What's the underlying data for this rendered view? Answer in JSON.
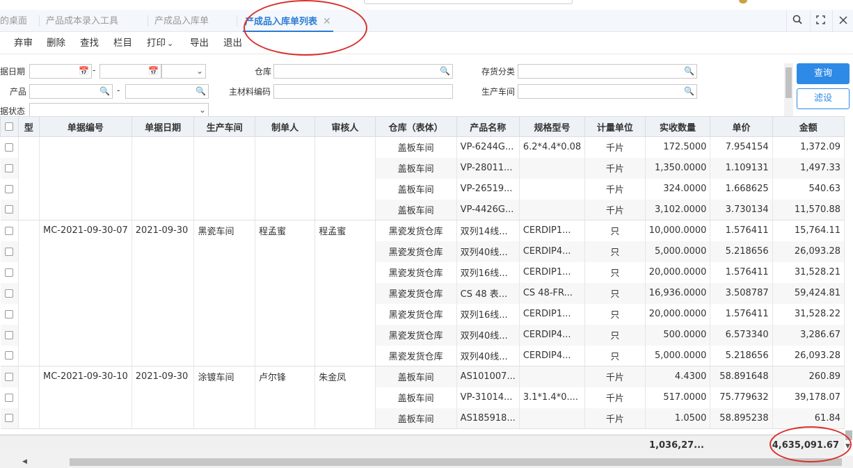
{
  "tabs": [
    {
      "label": "的桌面"
    },
    {
      "label": "产品成本录入工具"
    },
    {
      "label": "产成品入库单"
    },
    {
      "label": "产成品入库单列表",
      "close": "✕"
    }
  ],
  "toolbar": [
    "弃审",
    "删除",
    "查找",
    "栏目",
    "打印",
    "导出",
    "退出"
  ],
  "toolbar_print_caret": "⌄",
  "window_icons": [
    "search-icon",
    "fullscreen-icon",
    "close-icon"
  ],
  "filters": {
    "date_label": "据日期",
    "dash": "-",
    "warehouse_label": "仓库",
    "category_label": "存货分类",
    "product_label": "产品",
    "material_label": "主材料编码",
    "workshop_label": "生产车间",
    "status_label": "据状态"
  },
  "buttons": {
    "query": "查询",
    "filter": "滤设"
  },
  "columns": [
    "型",
    "单据编号",
    "单据日期",
    "生产车间",
    "制单人",
    "审核人",
    "仓库（表体）",
    "产品名称",
    "规格型号",
    "计量单位",
    "实收数量",
    "单价",
    "金额"
  ],
  "groups": [
    {
      "doc_no": "",
      "date": "",
      "workshop": "",
      "maker": "",
      "auditor": "",
      "rows": [
        {
          "wh": "盖板车间",
          "name": "VP-6244G...",
          "spec": "6.2*4.4*0.08",
          "unit": "千片",
          "qty": "172.5000",
          "price": "7.954154",
          "amount": "1,372.09"
        },
        {
          "wh": "盖板车间",
          "name": "VP-28011...",
          "spec": "",
          "unit": "千片",
          "qty": "1,350.0000",
          "price": "1.109131",
          "amount": "1,497.33"
        },
        {
          "wh": "盖板车间",
          "name": "VP-26519...",
          "spec": "",
          "unit": "千片",
          "qty": "324.0000",
          "price": "1.668625",
          "amount": "540.63"
        },
        {
          "wh": "盖板车间",
          "name": "VP-4426G...",
          "spec": "",
          "unit": "千片",
          "qty": "3,102.0000",
          "price": "3.730134",
          "amount": "11,570.88"
        }
      ]
    },
    {
      "doc_no": "MC-2021-09-30-07",
      "date": "2021-09-30",
      "workshop": "黑瓷车间",
      "maker": "程孟蜜",
      "auditor": "程孟蜜",
      "rows": [
        {
          "wh": "黑瓷发货仓库",
          "name": "双列14线...",
          "spec": "CERDIP1...",
          "unit": "只",
          "qty": "10,000.0000",
          "price": "1.576411",
          "amount": "15,764.11"
        },
        {
          "wh": "黑瓷发货仓库",
          "name": "双列40线...",
          "spec": "CERDIP4...",
          "unit": "只",
          "qty": "5,000.0000",
          "price": "5.218656",
          "amount": "26,093.28"
        },
        {
          "wh": "黑瓷发货仓库",
          "name": "双列16线...",
          "spec": "CERDIP1...",
          "unit": "只",
          "qty": "20,000.0000",
          "price": "1.576411",
          "amount": "31,528.21"
        },
        {
          "wh": "黑瓷发货仓库",
          "name": "CS 48 表...",
          "spec": "CS 48-FR...",
          "unit": "只",
          "qty": "16,936.0000",
          "price": "3.508787",
          "amount": "59,424.81"
        },
        {
          "wh": "黑瓷发货仓库",
          "name": "双列16线...",
          "spec": "CERDIP1...",
          "unit": "只",
          "qty": "20,000.0000",
          "price": "1.576411",
          "amount": "31,528.22"
        },
        {
          "wh": "黑瓷发货仓库",
          "name": "双列40线...",
          "spec": "CERDIP4...",
          "unit": "只",
          "qty": "500.0000",
          "price": "6.573340",
          "amount": "3,286.67"
        },
        {
          "wh": "黑瓷发货仓库",
          "name": "双列40线...",
          "spec": "CERDIP4...",
          "unit": "只",
          "qty": "5,000.0000",
          "price": "5.218656",
          "amount": "26,093.28"
        }
      ]
    },
    {
      "doc_no": "MC-2021-09-30-10",
      "date": "2021-09-30",
      "workshop": "涂镀车间",
      "maker": "卢尔锋",
      "auditor": "朱金凤",
      "rows": [
        {
          "wh": "盖板车间",
          "name": "AS101007...",
          "spec": "",
          "unit": "千片",
          "qty": "4.4300",
          "price": "58.891648",
          "amount": "260.89"
        },
        {
          "wh": "盖板车间",
          "name": "VP-31014...",
          "spec": "3.1*1.4*0....",
          "unit": "千片",
          "qty": "517.0000",
          "price": "75.779632",
          "amount": "39,178.07"
        },
        {
          "wh": "盖板车间",
          "name": "AS185918...",
          "spec": "",
          "unit": "千片",
          "qty": "1.0500",
          "price": "58.895238",
          "amount": "61.84"
        }
      ]
    }
  ],
  "totals": {
    "qty": "1,036,27...",
    "amount": "4,635,091.67"
  },
  "colors": {
    "accent": "#2b7bd6",
    "button": "#2d8ae6",
    "annotation": "#d9302c"
  }
}
